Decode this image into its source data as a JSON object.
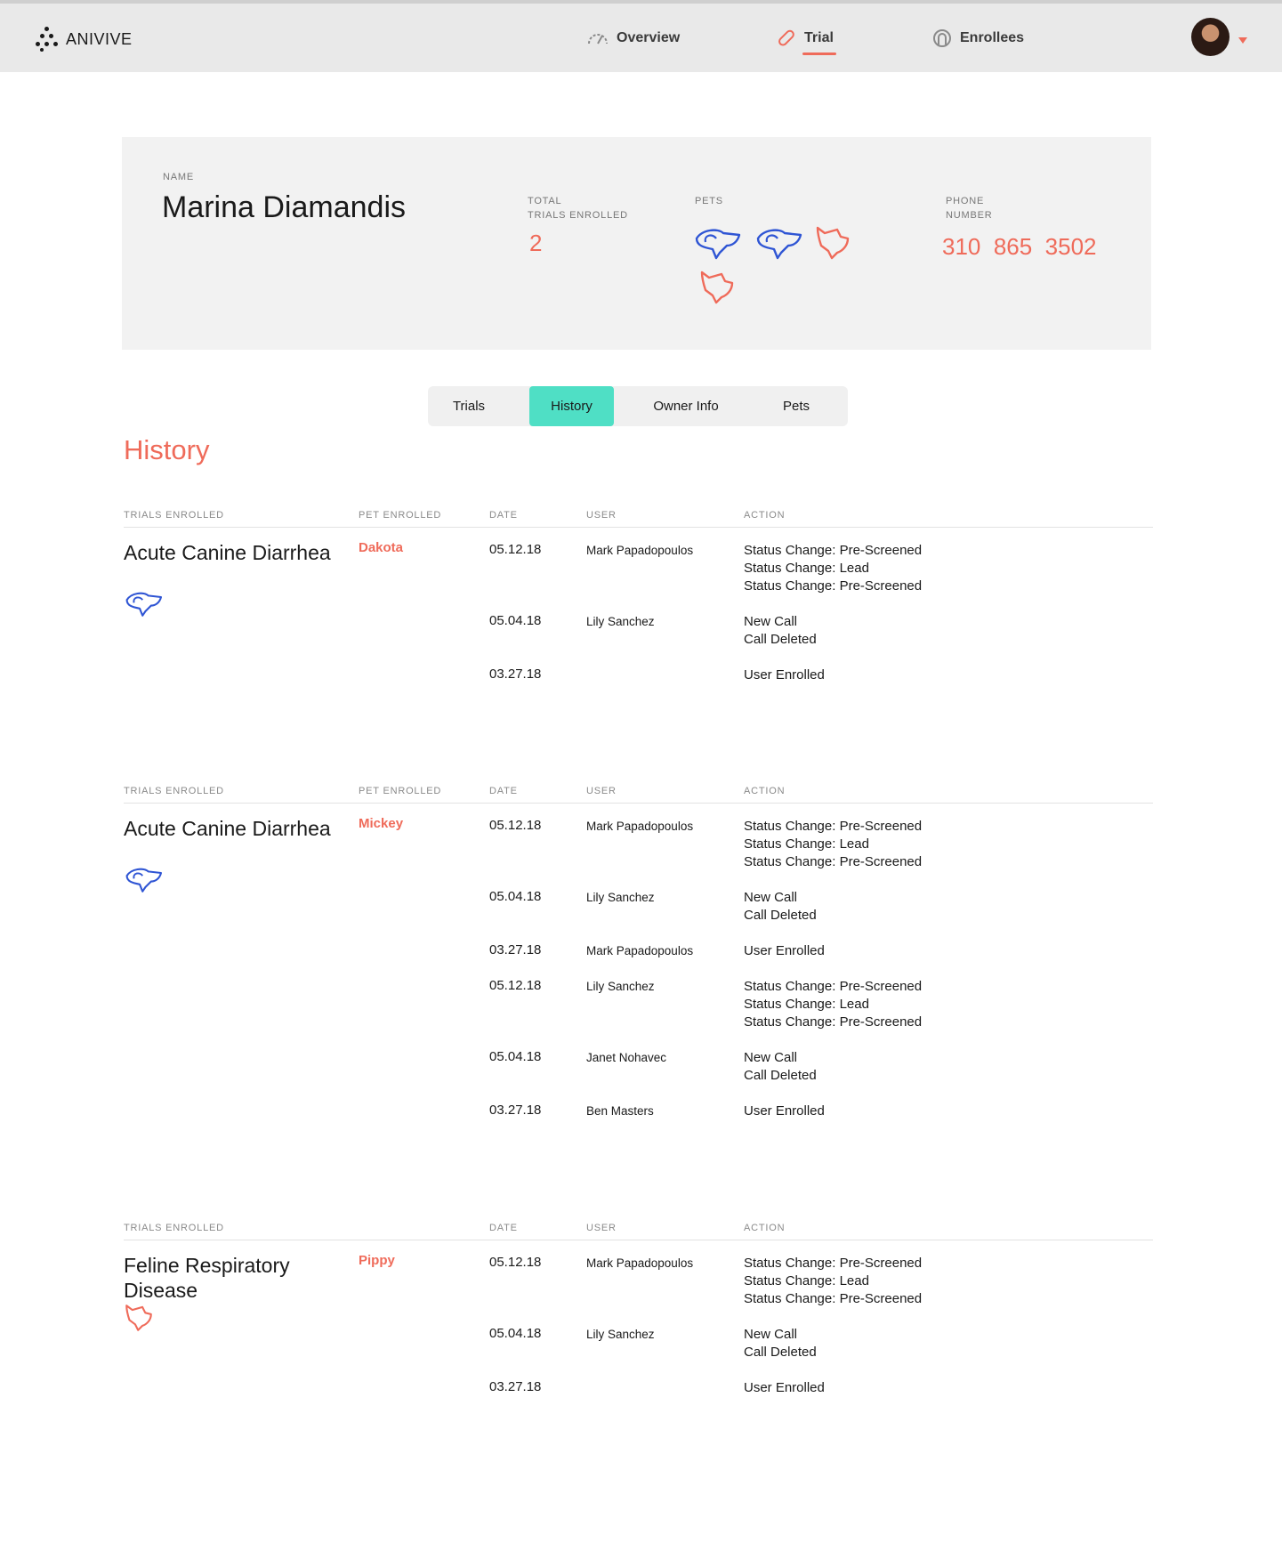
{
  "brand": {
    "name": "ANIVIVE"
  },
  "nav": {
    "overview": "Overview",
    "trial": "Trial",
    "enrollees": "Enrollees"
  },
  "colors": {
    "accent": "#ef6b5a",
    "tab_active": "#4fdfc5",
    "dog_icon": "#2f55d4",
    "cat_icon": "#ef6b5a"
  },
  "profile": {
    "name_label": "NAME",
    "name": "Marina Diamandis",
    "total_label_1": "TOTAL",
    "total_label_2": "TRIALS ENROLLED",
    "total_value": "2",
    "pets_label": "PETS",
    "pets_icons": [
      "dog-icon",
      "dog-icon",
      "cat-icon",
      "cat-icon"
    ],
    "phone_label_1": "PHONE",
    "phone_label_2": "NUMBER",
    "phone": "310  865  3502"
  },
  "tabs": [
    "Trials",
    "History",
    "Owner Info",
    "Pets"
  ],
  "active_tab": "History",
  "history_title": "History",
  "columns": {
    "trials": "TRIALS ENROLLED",
    "pet": "PET ENROLLED",
    "date": "DATE",
    "user": "USER",
    "action": "ACTION"
  },
  "blocks": [
    {
      "trial": "Acute Canine Diarrhea",
      "pet": "Dakota",
      "pet_icon": "dog-icon",
      "rows": [
        {
          "date": "05.12.18",
          "user": "Mark Papadopoulos",
          "actions": [
            "Status Change: Pre-Screened",
            "Status Change: Lead",
            "Status Change: Pre-Screened"
          ]
        },
        {
          "date": "05.04.18",
          "user": "Lily Sanchez",
          "actions": [
            "New Call",
            "Call Deleted"
          ]
        },
        {
          "date": "03.27.18",
          "user": "",
          "actions": [
            "User Enrolled"
          ]
        }
      ]
    },
    {
      "trial": "Acute Canine Diarrhea",
      "pet": "Mickey",
      "pet_icon": "dog-icon",
      "rows": [
        {
          "date": "05.12.18",
          "user": "Mark Papadopoulos",
          "actions": [
            "Status Change: Pre-Screened",
            "Status Change: Lead",
            "Status Change: Pre-Screened"
          ]
        },
        {
          "date": "05.04.18",
          "user": "Lily Sanchez",
          "actions": [
            "New Call",
            "Call Deleted"
          ]
        },
        {
          "date": "03.27.18",
          "user": "Mark Papadopoulos",
          "actions": [
            "User Enrolled"
          ]
        },
        {
          "date": "05.12.18",
          "user": "Lily Sanchez",
          "actions": [
            "Status Change: Pre-Screened",
            "Status Change: Lead",
            "Status Change: Pre-Screened"
          ]
        },
        {
          "date": "05.04.18",
          "user": "Janet Nohavec",
          "actions": [
            "New Call",
            "Call Deleted"
          ]
        },
        {
          "date": "03.27.18",
          "user": "Ben Masters",
          "actions": [
            "User Enrolled"
          ]
        }
      ]
    },
    {
      "trial": "Feline Respiratory Disease",
      "pet": "Pippy",
      "pet_icon": "cat-icon",
      "rows": [
        {
          "date": "05.12.18",
          "user": "Mark Papadopoulos",
          "actions": [
            "Status Change: Pre-Screened",
            "Status Change: Lead",
            "Status Change: Pre-Screened"
          ]
        },
        {
          "date": "05.04.18",
          "user": "Lily Sanchez",
          "actions": [
            "New Call",
            "Call Deleted"
          ]
        },
        {
          "date": "03.27.18",
          "user": "",
          "actions": [
            "User Enrolled"
          ]
        }
      ]
    }
  ]
}
